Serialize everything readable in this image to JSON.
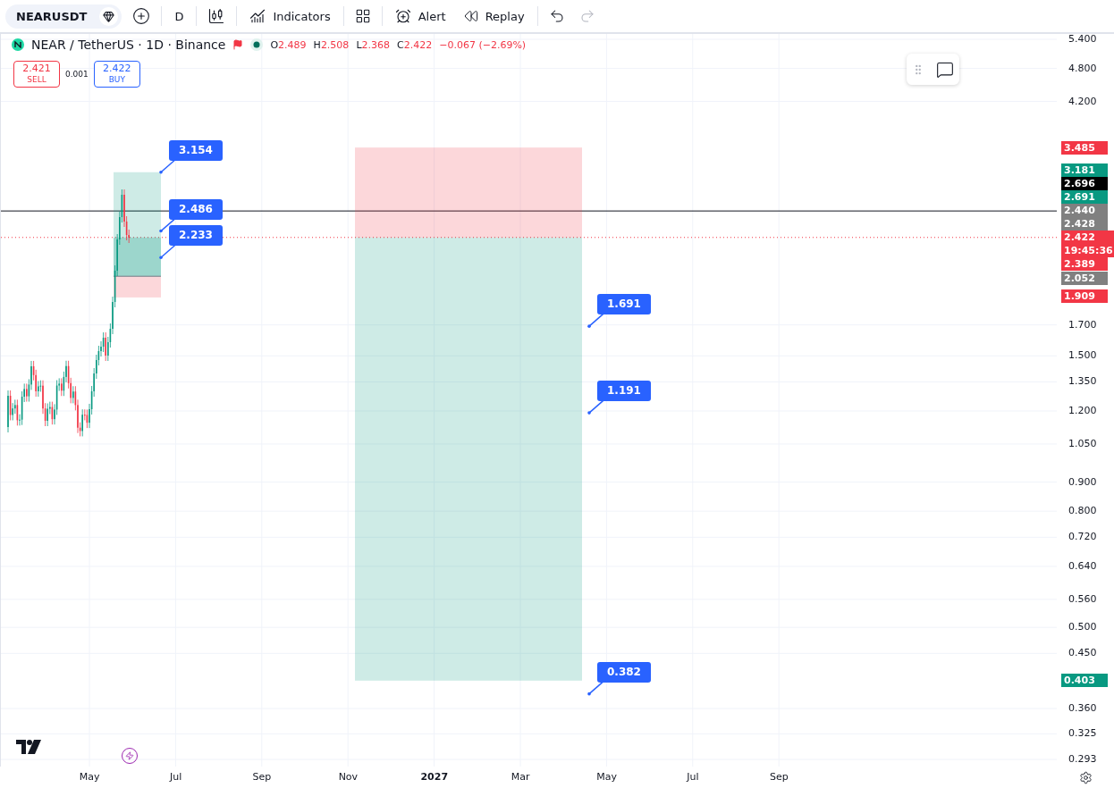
{
  "toolbar": {
    "symbol": "NEARUSDT",
    "interval": "D",
    "buttons": [
      {
        "kind": "indicators",
        "label": "Indicators"
      },
      {
        "kind": "alert",
        "label": "Alert"
      },
      {
        "kind": "replay",
        "label": "Replay"
      }
    ],
    "undo": {
      "disabled": false
    },
    "redo": {
      "disabled": true
    }
  },
  "legend": {
    "title": "NEAR / TetherUS · 1D · Binance",
    "ohlc": [
      {
        "label": "O",
        "value": "2.489"
      },
      {
        "label": "H",
        "value": "2.508"
      },
      {
        "label": "L",
        "value": "2.368"
      },
      {
        "label": "C",
        "value": "2.422"
      }
    ],
    "change": "−0.067 (−2.69%)"
  },
  "trade": {
    "sell": {
      "price": "2.421",
      "label": "SELL"
    },
    "spread": "0.001",
    "buy": {
      "price": "2.422",
      "label": "BUY"
    }
  },
  "positions": [
    {
      "kind": "long",
      "labels": [
        "3.154",
        "2.486",
        "2.233"
      ]
    },
    {
      "kind": "short",
      "labels": [
        "1.691",
        "1.191",
        "0.382"
      ]
    }
  ],
  "price_axis": {
    "ticks": [
      "5.400",
      "4.800",
      "4.200",
      "1.700",
      "1.500",
      "1.350",
      "1.200",
      "1.050",
      "0.900",
      "0.800",
      "0.720",
      "0.640",
      "0.560",
      "0.500",
      "0.450",
      "0.360",
      "0.325",
      "0.293"
    ],
    "badges": [
      {
        "text": "3.485",
        "color": "#f23645"
      },
      {
        "text": "3.181",
        "color": "#089981"
      },
      {
        "text": "2.696",
        "color": "#000000"
      },
      {
        "text": "2.691",
        "color": "#089981"
      },
      {
        "text": "2.440",
        "color": "#808080"
      },
      {
        "text": "2.428",
        "color": "#808080"
      },
      {
        "text": "2.422",
        "subtext": "19:45:36",
        "color": "#f23645",
        "kind": "current"
      },
      {
        "text": "2.389",
        "color": "#f23645"
      },
      {
        "text": "2.052",
        "color": "#808080"
      },
      {
        "text": "1.909",
        "color": "#f23645"
      },
      {
        "text": "0.403",
        "color": "#089981"
      }
    ]
  },
  "time_axis": [
    {
      "label": "May",
      "kind": "month"
    },
    {
      "label": "Jul",
      "kind": "month"
    },
    {
      "label": "Sep",
      "kind": "month"
    },
    {
      "label": "Nov",
      "kind": "month"
    },
    {
      "label": "2027",
      "kind": "year"
    },
    {
      "label": "Mar",
      "kind": "month"
    },
    {
      "label": "May",
      "kind": "month"
    },
    {
      "label": "Jul",
      "kind": "month"
    },
    {
      "label": "Sep",
      "kind": "month"
    }
  ]
}
